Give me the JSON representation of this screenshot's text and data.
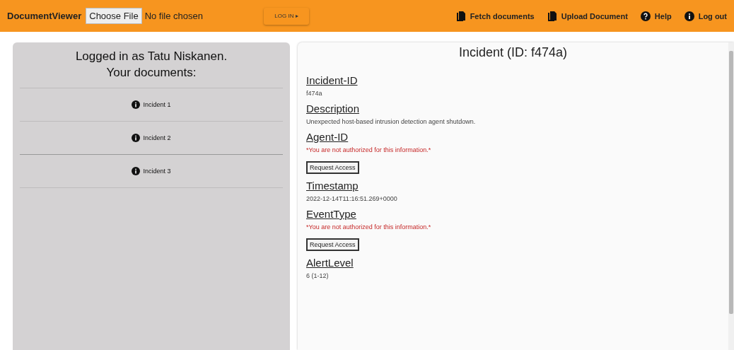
{
  "header": {
    "brand": "DocumentViewer",
    "file_button": "Choose File",
    "file_status": "No file chosen",
    "login_button": "LOG IN ▸",
    "actions": [
      {
        "kind": "documents",
        "label": "Fetch documents"
      },
      {
        "kind": "documents",
        "label": "Upload Document"
      },
      {
        "kind": "help",
        "label": "Help"
      },
      {
        "kind": "info",
        "label": "Log out"
      }
    ]
  },
  "sidebar": {
    "title_lines": [
      "Logged in as Tatu Niskanen.",
      "Your documents:"
    ],
    "items": [
      {
        "label": "Incident 1",
        "selected": false
      },
      {
        "label": "Incident 2",
        "selected": false
      },
      {
        "label": "Incident 3",
        "selected": false
      }
    ]
  },
  "document": {
    "title": "Incident (ID: f474a)",
    "fields": [
      {
        "kind": "value",
        "label": "Incident-ID",
        "value": "f474a"
      },
      {
        "kind": "value",
        "label": "Description",
        "value": "Unexpected host-based intrusion detection agent shutdown."
      },
      {
        "kind": "restricted",
        "label": "Agent-ID",
        "message": "*You are not authorized for this information.*",
        "button": "Request Access"
      },
      {
        "kind": "value",
        "label": "Timestamp",
        "value": "2022-12-14T11:16:51.269+0000"
      },
      {
        "kind": "restricted",
        "label": "EventType",
        "message": "*You are not authorized for this information.*",
        "button": "Request Access"
      },
      {
        "kind": "value",
        "label": "AlertLevel",
        "value": "6 (1-12)"
      }
    ]
  }
}
